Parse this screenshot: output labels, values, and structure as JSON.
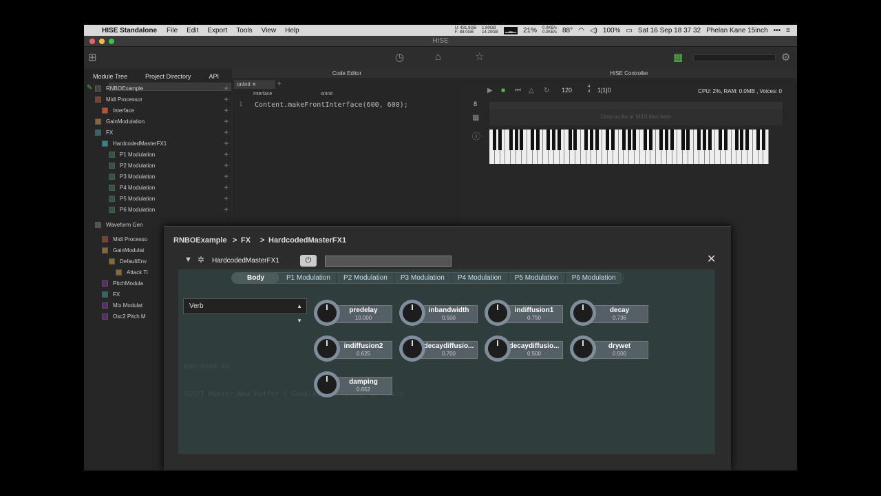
{
  "menubar": {
    "app_name": "HISE Standalone",
    "menus": [
      "File",
      "Edit",
      "Export",
      "Tools",
      "View",
      "Help"
    ],
    "disk_line1": "U: 431.9GB",
    "disk_line2": "F: 88.0GB",
    "ram_line1": "1.80GB",
    "ram_line2": "14.20GB",
    "cpu_percent": "21%",
    "net_line1": "0.0KB/s",
    "net_line2": "0.0KB/s",
    "temp": "88°",
    "battery": "100%",
    "clock": "Sat 16 Sep  18 37 32",
    "user": "Phelan Kane 15inch"
  },
  "window": {
    "title": "HISE"
  },
  "left_panel": {
    "tabs": [
      "Module Tree",
      "Project Directory",
      "API"
    ],
    "tree": [
      {
        "label": "RNBOExample",
        "color": "#444444"
      },
      {
        "label": "Midi Processor",
        "color": "#8a3a2a"
      },
      {
        "label": "Interface",
        "color": "#c0502a"
      },
      {
        "label": "GainModulation",
        "color": "#8a6a2a"
      },
      {
        "label": "FX",
        "color": "#2a6a6a"
      },
      {
        "label": "HardcodedMasterFX1",
        "color": "#2a8a8a"
      },
      {
        "label": "P1 Modulation",
        "color": "#2a5a3a"
      },
      {
        "label": "P2 Modulation",
        "color": "#2a5a3a"
      },
      {
        "label": "P3 Modulation",
        "color": "#2a5a3a"
      },
      {
        "label": "P4 Modulation",
        "color": "#2a5a3a"
      },
      {
        "label": "P5 Modulation",
        "color": "#2a5a3a"
      },
      {
        "label": "P6 Modulation",
        "color": "#2a5a3a"
      },
      {
        "label": "Waveform Gen",
        "color": "#555555"
      },
      {
        "label": "Midi Processo",
        "color": "#8a3a2a"
      },
      {
        "label": "GainModulat",
        "color": "#8a6a2a"
      },
      {
        "label": "DefaultEnv",
        "color": "#8a6a2a"
      },
      {
        "label": "Attack Ti",
        "color": "#8a6a2a"
      },
      {
        "label": "PitchModula",
        "color": "#5a2a6a"
      },
      {
        "label": "FX",
        "color": "#2a6a6a"
      },
      {
        "label": "Mix Modulat",
        "color": "#5a2a6a"
      },
      {
        "label": "Osc2 Pitch M",
        "color": "#5a2a6a"
      }
    ]
  },
  "editor": {
    "title": "Code Editor",
    "tab": "onInit",
    "combo1": "Interface",
    "combo2": "onInit",
    "line_number": "1",
    "code": "Content.makeFrontInterface(600, 600);"
  },
  "controller": {
    "title": "HISE Controller",
    "bpm": "120",
    "timesig_top": "4",
    "timesig_bottom": "4",
    "position": "1|1|0",
    "stats": "CPU: 2%, RAM: 0.0MB , Voices: 0",
    "octave": "8",
    "drop_hint": "Drop audio or MIDI files here"
  },
  "popup": {
    "breadcrumb": [
      "RNBOExample",
      "FX",
      "HardcodedMasterFX1"
    ],
    "module_name": "HardcodedMasterFX1",
    "tabs": [
      {
        "label": "Body",
        "active": true
      },
      {
        "label": "P1 Modulation",
        "active": false
      },
      {
        "label": "P2 Modulation",
        "active": false
      },
      {
        "label": "P3 Modulation",
        "active": false
      },
      {
        "label": "P4 Modulation",
        "active": false
      },
      {
        "label": "P5 Modulation",
        "active": false
      },
      {
        "label": "P6 Modulation",
        "active": false
      }
    ],
    "algorithm": "Verb",
    "knobs": [
      {
        "name": "predelay",
        "value": "10.000"
      },
      {
        "name": "inbandwidth",
        "value": "0.500"
      },
      {
        "name": "indiffusion1",
        "value": "0.750"
      },
      {
        "name": "decay",
        "value": "0.736"
      },
      {
        "name": "indiffusion2",
        "value": "0.625"
      },
      {
        "name": "decaydiffusio...",
        "value": "0.700"
      },
      {
        "name": "decaydiffusio...",
        "value": "0.500"
      },
      {
        "name": "drywet",
        "value": "0.500"
      },
      {
        "name": "damping",
        "value": "0.652"
      }
    ],
    "ghost_line1": "ndo(0x40 80",
    "ghost_line2": "SGO/I Master Now Buffer         C       Samplerate: 48000, BF'Res'n"
  }
}
